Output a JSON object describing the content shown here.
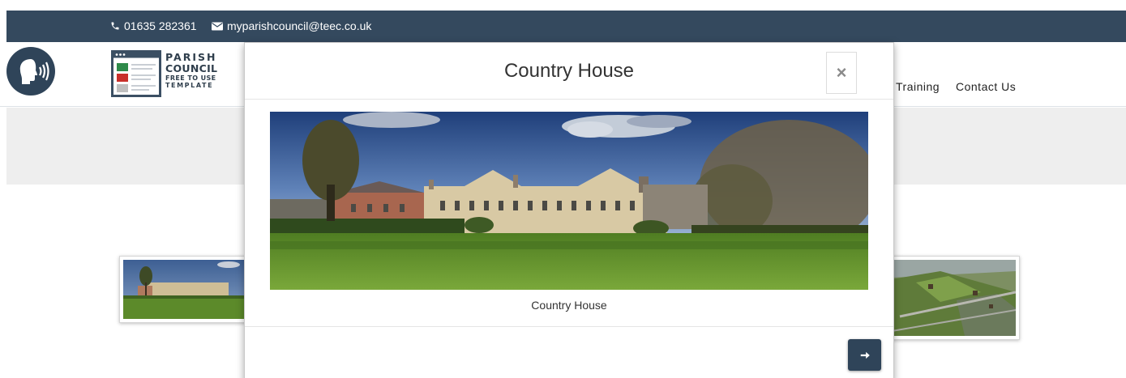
{
  "topbar": {
    "phone": "01635 282361",
    "email": "myparishcouncil@teec.co.uk",
    "icons": [
      "phone-icon",
      "envelope-icon"
    ]
  },
  "header": {
    "logo": {
      "line1": "PARISH",
      "line2": "COUNCIL",
      "line3": "FREE TO USE",
      "line4": "TEMPLATE"
    },
    "nav": {
      "training": "Training",
      "contact": "Contact Us"
    },
    "speech_icon": "speaking-head-icon"
  },
  "modal": {
    "title": "Country House",
    "close_label": "×",
    "caption": "Country House",
    "next_icon": "arrow-right-icon"
  },
  "colors": {
    "topbar_bg": "#34495e",
    "accent": "#2f4459",
    "banner_bg": "#eeeeee"
  }
}
